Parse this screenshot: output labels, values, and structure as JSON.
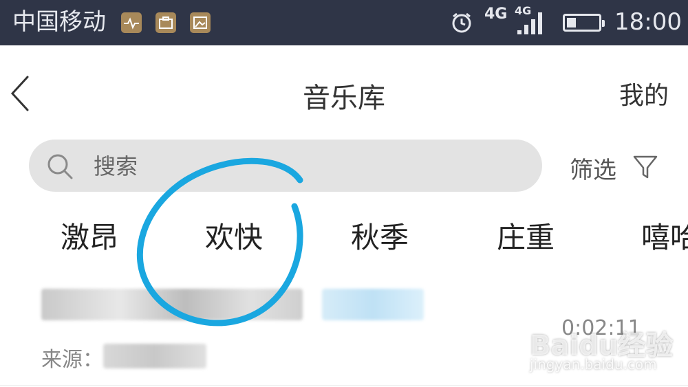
{
  "status_bar": {
    "carrier": "中国移动",
    "network_primary": "4G",
    "network_secondary": "4G",
    "time": "18:00",
    "battery_level": 0.3
  },
  "header": {
    "title": "音乐库",
    "right_label": "我的"
  },
  "search": {
    "placeholder": "搜索"
  },
  "filter": {
    "label": "筛选"
  },
  "tags": [
    "激昂",
    "欢快",
    "秋季",
    "庄重",
    "嘻哈"
  ],
  "list_item": {
    "duration": "0:02:11",
    "source_label": "来源："
  },
  "watermark": {
    "brand": "Baidu经验",
    "url": "jingyan.baidu.com"
  },
  "colors": {
    "status_bar_bg": "#2f3547",
    "search_bg": "#e3e3e3",
    "annotation_circle": "#1aa7e0"
  }
}
